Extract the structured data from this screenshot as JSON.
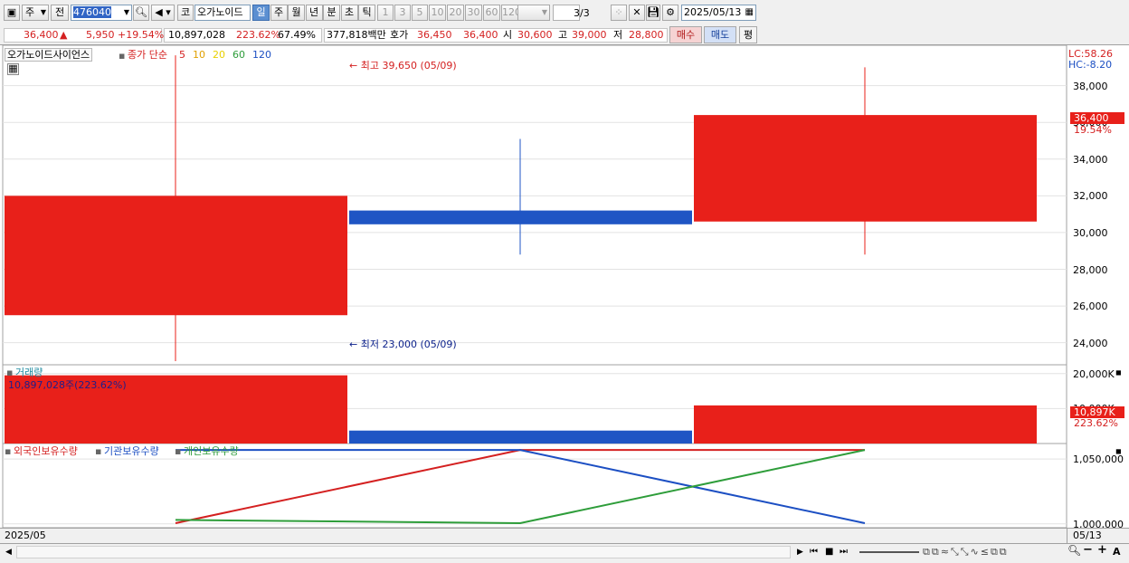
{
  "toolbar": {
    "type_select": "주",
    "prev_label": "전",
    "code_value": "476040",
    "market_label": "코",
    "stock_name": "오가노이드",
    "periods": [
      "일",
      "주",
      "월",
      "년",
      "분",
      "초",
      "틱"
    ],
    "active_period": "일",
    "intervals": [
      "1",
      "3",
      "5",
      "10",
      "20",
      "30",
      "60",
      "120"
    ],
    "page_indicator": "3/3",
    "date_value": "2025/05/13"
  },
  "quote": {
    "price": "36,400",
    "change": "5,950",
    "change_pct": "+19.54%",
    "volume": "10,897,028",
    "volume_ratio": "223.62%",
    "turnover": "67.49%",
    "amount": "377,818백만",
    "ask_label": "호가",
    "ask": "36,450",
    "bid": "36,400",
    "open_label": "시",
    "open": "30,600",
    "high_label": "고",
    "high": "39,000",
    "low_label": "저",
    "low": "28,800",
    "buy_label": "매수",
    "sell_label": "매도",
    "eval_label": "평"
  },
  "price_panel": {
    "stock_label": "오가노이드사이언스",
    "indicator_label": "종가 단순",
    "ma_labels": [
      "5",
      "10",
      "20",
      "60",
      "120"
    ],
    "ma_colors": [
      "#d42020",
      "#e0a000",
      "#e8d000",
      "#2e9d3a",
      "#1c4fc3"
    ],
    "high_marker": "최고 39,650 (05/09)",
    "low_marker": "최저 23,000 (05/09)",
    "lc": "LC:58.26",
    "hc": "HC:-8.20",
    "current_tag": "36,400",
    "current_pct": "19.54%",
    "y_ticks": [
      "38,000",
      "36,000",
      "34,000",
      "32,000",
      "30,000",
      "28,000",
      "26,000",
      "24,000"
    ]
  },
  "volume_panel": {
    "title": "거래량",
    "info": "10,897,028주(223.62%)",
    "y_ticks": [
      "20,000K",
      "10,000K"
    ],
    "current_tag": "10,897K",
    "current_pct": "223.62%"
  },
  "holding_panel": {
    "legends": [
      "외국인보유수량",
      "기관보유수량",
      "개인보유수량"
    ],
    "legend_colors": [
      "#d42020",
      "#1c4fc3",
      "#2e9d3a"
    ],
    "y_ticks": [
      "1,050,000",
      "1,000,000"
    ]
  },
  "axis": {
    "left_date": "2025/05",
    "right_date": "05/13"
  },
  "chart_data": [
    {
      "type": "candlestick",
      "title": "오가노이드사이언스",
      "candles": [
        {
          "open": 25500,
          "close": 32000,
          "high": 39650,
          "low": 23000,
          "color": "up"
        },
        {
          "open": 31200,
          "close": 30450,
          "high": 35100,
          "low": 28800,
          "color": "down"
        },
        {
          "open": 30600,
          "close": 36400,
          "high": 39000,
          "low": 28800,
          "color": "up"
        }
      ],
      "ylim": [
        22800,
        40200
      ]
    },
    {
      "type": "bar",
      "title": "거래량",
      "values": [
        19500000,
        3700000,
        10897028
      ],
      "colors": [
        "up",
        "down",
        "up"
      ]
    },
    {
      "type": "line",
      "series": [
        {
          "name": "외국인보유수량",
          "values": [
            1000500,
            1057000,
            1057000
          ]
        },
        {
          "name": "기관보유수량",
          "values": [
            1057000,
            1057000,
            1000500
          ]
        },
        {
          "name": "개인보유수량",
          "values": [
            1003000,
            1000500,
            1057000
          ]
        }
      ],
      "ylim": [
        997000,
        1062000
      ]
    }
  ]
}
